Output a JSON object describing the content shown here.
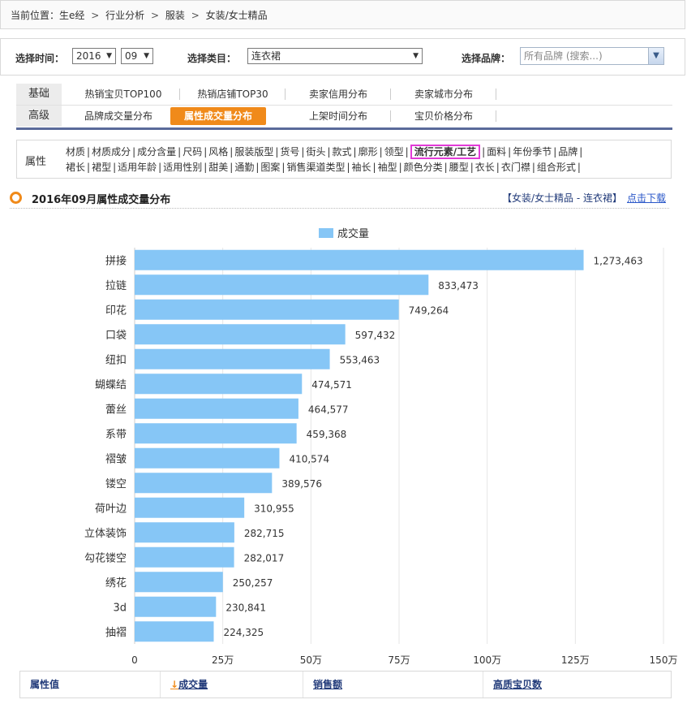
{
  "breadcrumb": {
    "prefix": "当前位置：",
    "items": [
      "生e经",
      "行业分析",
      "服装",
      "女装/女士精品"
    ],
    "separator": ">"
  },
  "filters": {
    "time_label": "选择时间：",
    "year": "2016",
    "month": "09",
    "category_label": "选择类目：",
    "category": "连衣裙",
    "brand_label": "选择品牌：",
    "brand_placeholder": "所有品牌 (搜索...)"
  },
  "tabs": {
    "row1_head": "基础",
    "row1": [
      "热销宝贝TOP100",
      "热销店铺TOP30",
      "卖家信用分布",
      "卖家城市分布"
    ],
    "row2_head": "高级",
    "row2": [
      "品牌成交量分布",
      "属性成交量分布",
      "上架时间分布",
      "宝贝价格分布"
    ],
    "active": "属性成交量分布"
  },
  "attributes": {
    "label": "属性",
    "line1": [
      "材质",
      "材质成分",
      "成分含量",
      "尺码",
      "风格",
      "服装版型",
      "货号",
      "街头",
      "款式",
      "廓形",
      "领型",
      "流行元素/工艺",
      "面料",
      "年份季节",
      "品牌"
    ],
    "line2": [
      "裙长",
      "裙型",
      "适用年龄",
      "适用性别",
      "甜美",
      "通勤",
      "图案",
      "销售渠道类型",
      "袖长",
      "袖型",
      "颜色分类",
      "腰型",
      "衣长",
      "衣门襟",
      "组合形式"
    ],
    "highlighted": "流行元素/工艺"
  },
  "section": {
    "title": "2016年09月属性成交量分布",
    "scope": "【女装/女士精品 - 连衣裙】",
    "download": "点击下载"
  },
  "colors": {
    "bar": "#86c6f6",
    "accent": "#f08a1a",
    "highlight_border": "#e23bd7",
    "link": "#2856c8"
  },
  "chart_data": {
    "type": "bar",
    "orientation": "horizontal",
    "series": [
      {
        "name": "成交量",
        "values": [
          1273463,
          833473,
          749264,
          597432,
          553463,
          474571,
          464577,
          459368,
          410574,
          389576,
          310955,
          282715,
          282017,
          250257,
          230841,
          224325
        ]
      }
    ],
    "categories": [
      "拼接",
      "拉链",
      "印花",
      "口袋",
      "纽扣",
      "蝴蝶结",
      "蕾丝",
      "系带",
      "褶皱",
      "镂空",
      "荷叶边",
      "立体装饰",
      "勾花镂空",
      "绣花",
      "3d",
      "抽褶"
    ],
    "value_labels": [
      "1,273,463",
      "833,473",
      "749,264",
      "597,432",
      "553,463",
      "474,571",
      "464,577",
      "459,368",
      "410,574",
      "389,576",
      "310,955",
      "282,715",
      "282,017",
      "250,257",
      "230,841",
      "224,325"
    ],
    "xlim": [
      0,
      1500000
    ],
    "xticks": [
      0,
      250000,
      500000,
      750000,
      1000000,
      1250000,
      1500000
    ],
    "xtick_labels": [
      "0",
      "25万",
      "50万",
      "75万",
      "100万",
      "125万",
      "150万"
    ],
    "legend": "top-center",
    "grid": true
  },
  "table": {
    "headers": [
      "属性值",
      "成交量",
      "销售额",
      "高质宝贝数"
    ],
    "sort_icon": "arrow-down-icon"
  }
}
